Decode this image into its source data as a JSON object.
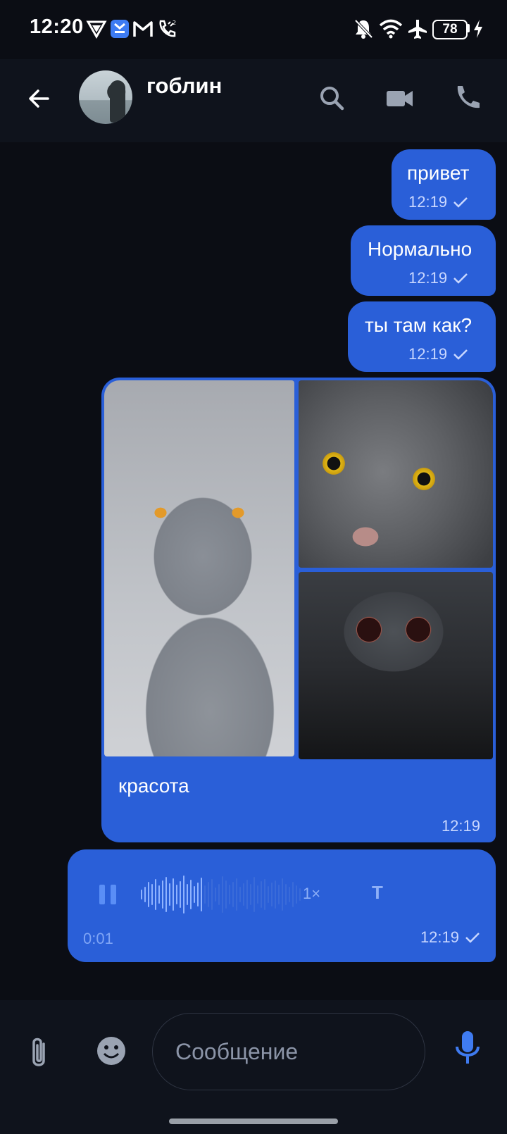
{
  "status_bar": {
    "time": "12:20",
    "battery": "78",
    "left_icons": [
      "vpn-icon",
      "app-notification-icon",
      "gmail-icon",
      "wifi-call-icon"
    ],
    "right_icons": [
      "bell-off-icon",
      "wifi-icon",
      "airplane-icon",
      "battery-icon",
      "charging-icon"
    ]
  },
  "header": {
    "contact_name": "гоблин",
    "icons": [
      "back-arrow-icon",
      "search-icon",
      "video-call-icon",
      "phone-icon"
    ]
  },
  "messages": [
    {
      "type": "text",
      "text": "привет",
      "time": "12:19",
      "read": true
    },
    {
      "type": "text",
      "text": "Нормально",
      "time": "12:19",
      "read": true
    },
    {
      "type": "text",
      "text": "ты там как?",
      "time": "12:19",
      "read": true
    },
    {
      "type": "media",
      "caption": "красота",
      "time": "12:19",
      "photos": [
        "grey-cat-photo",
        "tabby-cat-yellow-eyes-photo",
        "cat-with-sunglasses-photo"
      ]
    },
    {
      "type": "voice",
      "duration": "0:01",
      "speed": "1×",
      "transcribe_label": "T",
      "time": "12:19",
      "read": true,
      "progress": 0.4
    }
  ],
  "composer": {
    "placeholder": "Сообщение",
    "icons": [
      "attach-icon",
      "emoji-icon",
      "microphone-icon"
    ]
  },
  "colors": {
    "background": "#0b0d14",
    "bar": "#0f131c",
    "bubble": "#2a5fd8",
    "accent": "#3f7bf0"
  }
}
